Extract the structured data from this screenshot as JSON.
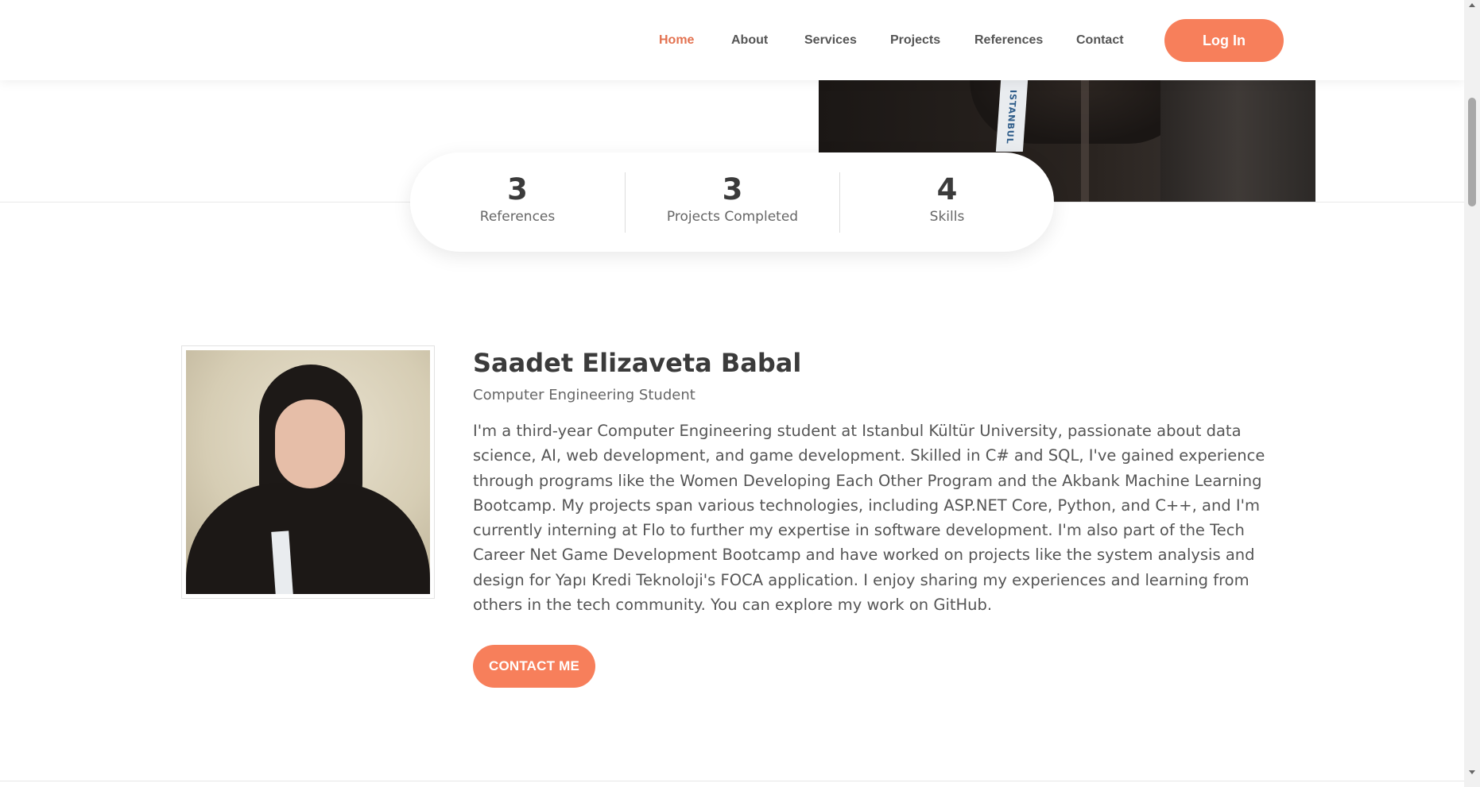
{
  "nav": {
    "items": [
      {
        "label": "Home",
        "active": true
      },
      {
        "label": "About"
      },
      {
        "label": "Services"
      },
      {
        "label": "Projects"
      },
      {
        "label": "References"
      },
      {
        "label": "Contact"
      }
    ],
    "login_label": "Log In"
  },
  "hero": {
    "lanyard_text": "ISTANBUL"
  },
  "stats": [
    {
      "value": "3",
      "label": "References"
    },
    {
      "value": "3",
      "label": "Projects Completed"
    },
    {
      "value": "4",
      "label": "Skills"
    }
  ],
  "about": {
    "name": "Saadet Elizaveta Babal",
    "subtitle": "Computer Engineering Student",
    "bio": "I'm a third-year Computer Engineering student at Istanbul Kültür University, passionate about data science, AI, web development, and game development. Skilled in C# and SQL, I've gained experience through programs like the Women Developing Each Other Program and the Akbank Machine Learning Bootcamp. My projects span various technologies, including ASP.NET Core, Python, and C++, and I'm currently interning at Flo to further my expertise in software development. I'm also part of the Tech Career Net Game Development Bootcamp and have worked on projects like the system analysis and design for Yapı Kredi Teknoloji's FOCA application. I enjoy sharing my experiences and learning from others in the tech community. You can explore my work on GitHub.",
    "contact_label": "CONTACT ME"
  },
  "colors": {
    "accent": "#f77f5b",
    "active_nav": "#e37250"
  }
}
